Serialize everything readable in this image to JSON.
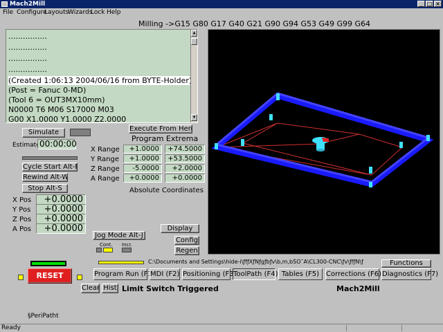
{
  "window": {
    "title": "Mach2Mill"
  },
  "menu": [
    "File",
    "Configure",
    "Layouts",
    "Wizards",
    "Lock",
    "Help"
  ],
  "header": {
    "modal_line": "Milling ->G15  G80 G17 G40 G21 G90 G94 G53 G49 G99 G64"
  },
  "gcode": {
    "lines": [
      "................",
      "................",
      "................",
      "................",
      "(Created 1:06:13 2004/06/16 from BYTE-Holder)",
      "(Post = Fanuc 0-MD)",
      "(Tool 6 = OUT3MX10mm)",
      "N0000 T6 M06 S17000 M03",
      "G00 X1.0000 Y1.0000 Z2.0000"
    ]
  },
  "controls": {
    "simulate": "Simulate",
    "estimate_label": "Estimate",
    "estimate_value": "00:00:00",
    "cycle_start": "Cycle Start Alt-R",
    "rewind": "Rewind Alt-W",
    "stop": "Stop Alt-S",
    "execute_from_here": "Execute From Here"
  },
  "extrema": {
    "title": "Program Extrema",
    "rows": [
      {
        "label": "X Range",
        "min": "+1.0000",
        "max": "+74.5000"
      },
      {
        "label": "Y Range",
        "min": "+1.0000",
        "max": "+53.5000"
      },
      {
        "label": "Z Range",
        "min": "-5.0000",
        "max": "+2.0000"
      },
      {
        "label": "A Range",
        "min": "+0.0000",
        "max": "+0.0000"
      }
    ],
    "footer": "Absolute Coordinates"
  },
  "positions": [
    {
      "label": "X Pos",
      "value": "+0.0000"
    },
    {
      "label": "Y Pos",
      "value": "+0.0000"
    },
    {
      "label": "Z Pos",
      "value": "+0.0000"
    },
    {
      "label": "A Pos",
      "value": "+0.0000"
    }
  ],
  "jog": {
    "button": "Jog Mode Alt-J",
    "cont": "Cont.",
    "incr": "Incr."
  },
  "view_buttons": {
    "display": "Display",
    "config": "Config",
    "regen": "Regen"
  },
  "reset": {
    "label": "RESET"
  },
  "file_path": "C:\\Documents and Settings\\hide-i\\ƒfƒXƒNƒgƒbƒv\\b,m,bŠÖ˜A\\CL300-CNC\\ƒv\\ƒfƒN\\ƒ",
  "functions_label": "Functions",
  "tabs": [
    "Program Run (F1)",
    "MDI (F2)",
    "Positioning (F3)",
    "ToolPath (F4)",
    "Tables (F5)",
    "Corrections (F6)",
    "Diagnostics (F7)"
  ],
  "bottom": {
    "clear": "Clear",
    "hist": "Hist",
    "message": "Limit Switch Triggered",
    "brand": "Mach2Mill",
    "overlay_text": "§PeriPatht"
  },
  "statusbar": {
    "text": "Ready"
  },
  "colors": {
    "title_bar": "#0a246a",
    "panel": "#c0c0c0",
    "field": "#c3d9c3",
    "reset": "#e02020",
    "table_edge": "#1a1aff"
  }
}
